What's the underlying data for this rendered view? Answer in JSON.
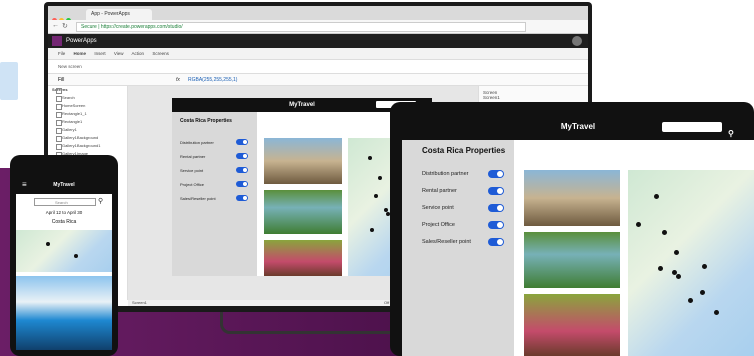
{
  "browser": {
    "tab_title": "App - PowerApps",
    "url": "Secure | https://create.powerapps.com/studio/"
  },
  "powerapps": {
    "brand": "PowerApps",
    "menu": [
      "File",
      "Home",
      "Insert",
      "View",
      "Action",
      "Screens"
    ],
    "ribbon_new_screen": "New screen",
    "formula_property": "Fill",
    "formula": "RGBA(255,255,255,1)",
    "tree_header": "Screens",
    "tree_items": [
      "Search",
      "HomeScreen",
      "Rectangle1_1",
      "Rectangle1",
      "Gallery1",
      "Gallery1Background",
      "Gallery1Background1",
      "Gallery1Image"
    ],
    "props_header": "Screen",
    "props_sub": "Screen1",
    "status_screen": "Screen1",
    "status_preview": "Off"
  },
  "app": {
    "title": "MyTravel",
    "section_title": "Costa Rica Properties",
    "toggles": [
      "Distribution partner",
      "Rental partner",
      "Service point",
      "Project Office",
      "Sales/Reseller point"
    ]
  },
  "phone": {
    "title": "MyTravel",
    "search_placeholder": "Search",
    "dates": "April 12 to April 30",
    "country": "Costa Rica"
  },
  "colors": {
    "accent_toggle": "#1e5bd6",
    "header_black": "#111111",
    "panel_gray": "#d9d9d9",
    "background_purple": "#5a1559"
  }
}
